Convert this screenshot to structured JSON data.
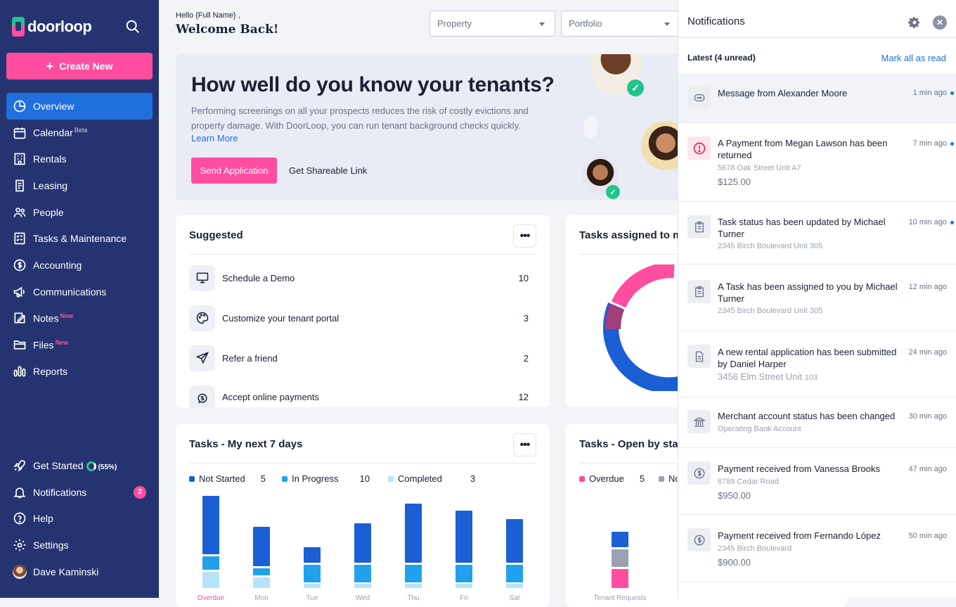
{
  "sidebar": {
    "logo_text": "doorloop",
    "create_label": "Create New",
    "items": [
      {
        "label": "Overview",
        "icon": "overview-icon",
        "active": true
      },
      {
        "label": "Calendar",
        "icon": "calendar-icon",
        "tag": "Beta"
      },
      {
        "label": "Rentals",
        "icon": "rentals-icon"
      },
      {
        "label": "Leasing",
        "icon": "leasing-icon"
      },
      {
        "label": "People",
        "icon": "people-icon"
      },
      {
        "label": "Tasks & Maintenance",
        "icon": "tasks-icon"
      },
      {
        "label": "Accounting",
        "icon": "accounting-icon"
      },
      {
        "label": "Communications",
        "icon": "communications-icon"
      },
      {
        "label": "Notes",
        "icon": "notes-icon",
        "tag": "New"
      },
      {
        "label": "Files",
        "icon": "files-icon",
        "tag": "New"
      },
      {
        "label": "Reports",
        "icon": "reports-icon"
      }
    ],
    "bottom": {
      "get_started": "Get Started",
      "get_started_progress": "(55%)",
      "get_started_progress_value": 55,
      "notifications": "Notifications",
      "notifications_count": "2",
      "help": "Help",
      "settings": "Settings",
      "user": "Dave Kaminski"
    }
  },
  "header": {
    "hello": "Hello {Full Name} ,",
    "welcome": "Welcome Back!",
    "property_placeholder": "Property",
    "portfolio_placeholder": "Portfolio"
  },
  "hero": {
    "title": "How well do you know your tenants?",
    "text": "Performing screenings on all your prospects reduces the risk of costly evictions and property damage. With DoorLoop, you can run tenant background checks quickly.",
    "learn_more": "Learn More",
    "send_button": "Send Application",
    "share_link": "Get Shareable Link"
  },
  "suggested": {
    "title": "Suggested",
    "items": [
      {
        "label": "Schedule a Demo",
        "count": "10",
        "icon": "monitor-icon"
      },
      {
        "label": "Customize your tenant portal",
        "count": "3",
        "icon": "palette-icon"
      },
      {
        "label": "Refer a friend",
        "count": "2",
        "icon": "send-icon"
      },
      {
        "label": "Accept online payments",
        "count": "12",
        "icon": "payment-icon"
      }
    ]
  },
  "tasks_assigned": {
    "title": "Tasks assigned to me"
  },
  "tasks_next7": {
    "title": "Tasks - My next 7 days",
    "legend": [
      {
        "label": "Not Started",
        "count": "5",
        "color": "#1a5fd4"
      },
      {
        "label": "In Progress",
        "count": "10",
        "color": "#21a1ec"
      },
      {
        "label": "Completed",
        "count": "3",
        "color": "#b6e3fa"
      }
    ],
    "day_labels": [
      "Overdue",
      "Mon",
      "Tue",
      "Wed",
      "Thu",
      "Fri",
      "Sat"
    ]
  },
  "tasks_open": {
    "title": "Tasks - Open by status",
    "legend": [
      {
        "label": "Overdue",
        "count": "5",
        "color": "#ff4da0"
      },
      {
        "label": "No",
        "color": "#9aa1b2"
      }
    ],
    "category_label": "Tenant Requests"
  },
  "panel": {
    "title": "Notifications",
    "latest": "Latest (4 unread)",
    "mark_all": "Mark all as read",
    "items": [
      {
        "title": "Message from Alexander Moore",
        "time": "1 min ago",
        "icon": "message-icon",
        "unread": true
      },
      {
        "title": "A Payment from Megan Lawson has been returned",
        "sub": "5678 Oak Street Unit A7",
        "amount": "$125.00",
        "time": "7 min ago",
        "icon": "alert-icon",
        "unread": true
      },
      {
        "title": "Task status has been updated by Michael Turner",
        "sub": "2345 Birch Boulevard Unit 305",
        "time": "10 min ago",
        "icon": "clipboard-icon",
        "unread": true
      },
      {
        "title": "A Task has been assigned to you by Michael Turner",
        "sub": "2345 Birch Boulevard Unit 305",
        "time": "12 min ago",
        "icon": "clipboard-icon"
      },
      {
        "title": "A new rental application has been submitted by Daniel Harper",
        "sub": "3456 Elm Street Unit",
        "sub_small": "103",
        "time": "24 min ago",
        "icon": "document-icon"
      },
      {
        "title": "Merchant account status has been changed",
        "sub": "Operating Bank Account",
        "time": "30 min ago",
        "icon": "bank-icon"
      },
      {
        "title": "Payment received from Vanessa Brooks",
        "sub": "6789 Cedar Road",
        "amount": "$950.00",
        "time": "47 min ago",
        "icon": "dollar-icon"
      },
      {
        "title": "Payment received from Fernando López",
        "sub": "2345 Birch Boulevard",
        "amount": "$900.00",
        "time": "50 min ago",
        "icon": "dollar-icon"
      }
    ]
  }
}
